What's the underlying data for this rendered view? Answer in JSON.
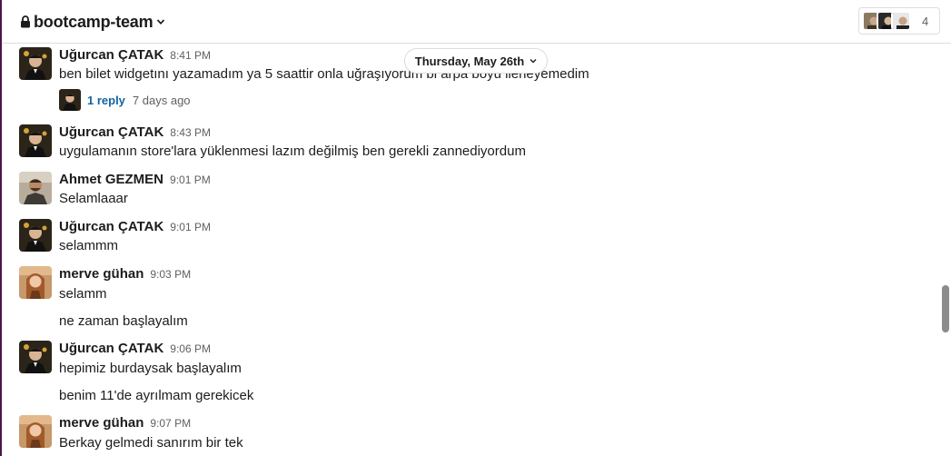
{
  "header": {
    "channel_title": "bootcamp-team",
    "member_count": "4",
    "icons": [
      "lock-icon",
      "chevron-down-icon"
    ]
  },
  "date_divider": {
    "label": "Thursday, May 26th"
  },
  "messages": [
    {
      "author": "Uğurcan ÇATAK",
      "time": "8:41 PM",
      "text": "ben bilet widgetını yazamadım ya 5 saattir onla uğraşıyorum bi arpa boyu ilerleyemedim",
      "thread": {
        "replies": "1 reply",
        "ago": "7 days ago"
      }
    },
    {
      "author": "Uğurcan ÇATAK",
      "time": "8:43 PM",
      "text": "uygulamanın store'lara yüklenmesi lazım değilmiş ben gerekli zannediyordum"
    },
    {
      "author": "Ahmet GEZMEN",
      "time": "9:01 PM",
      "text": "Selamlaaar"
    },
    {
      "author": "Uğurcan ÇATAK",
      "time": "9:01 PM",
      "text": "selammm"
    },
    {
      "author": "merve gühan",
      "time": "9:03 PM",
      "text": "selamm",
      "followup": "ne zaman başlayalım"
    },
    {
      "author": "Uğurcan ÇATAK",
      "time": "9:06 PM",
      "text": "hepimiz burdaysak başlayalım",
      "followup": "benim 11'de ayrılmam gerekicek"
    },
    {
      "author": "merve gühan",
      "time": "9:07 PM",
      "text": "Berkay gelmedi sanırım bir tek"
    }
  ],
  "colors": {
    "link": "#1264a3",
    "text": "#1d1c1d",
    "muted": "#616061",
    "border": "#dddddd",
    "sidebar_edge": "#4a154b"
  }
}
